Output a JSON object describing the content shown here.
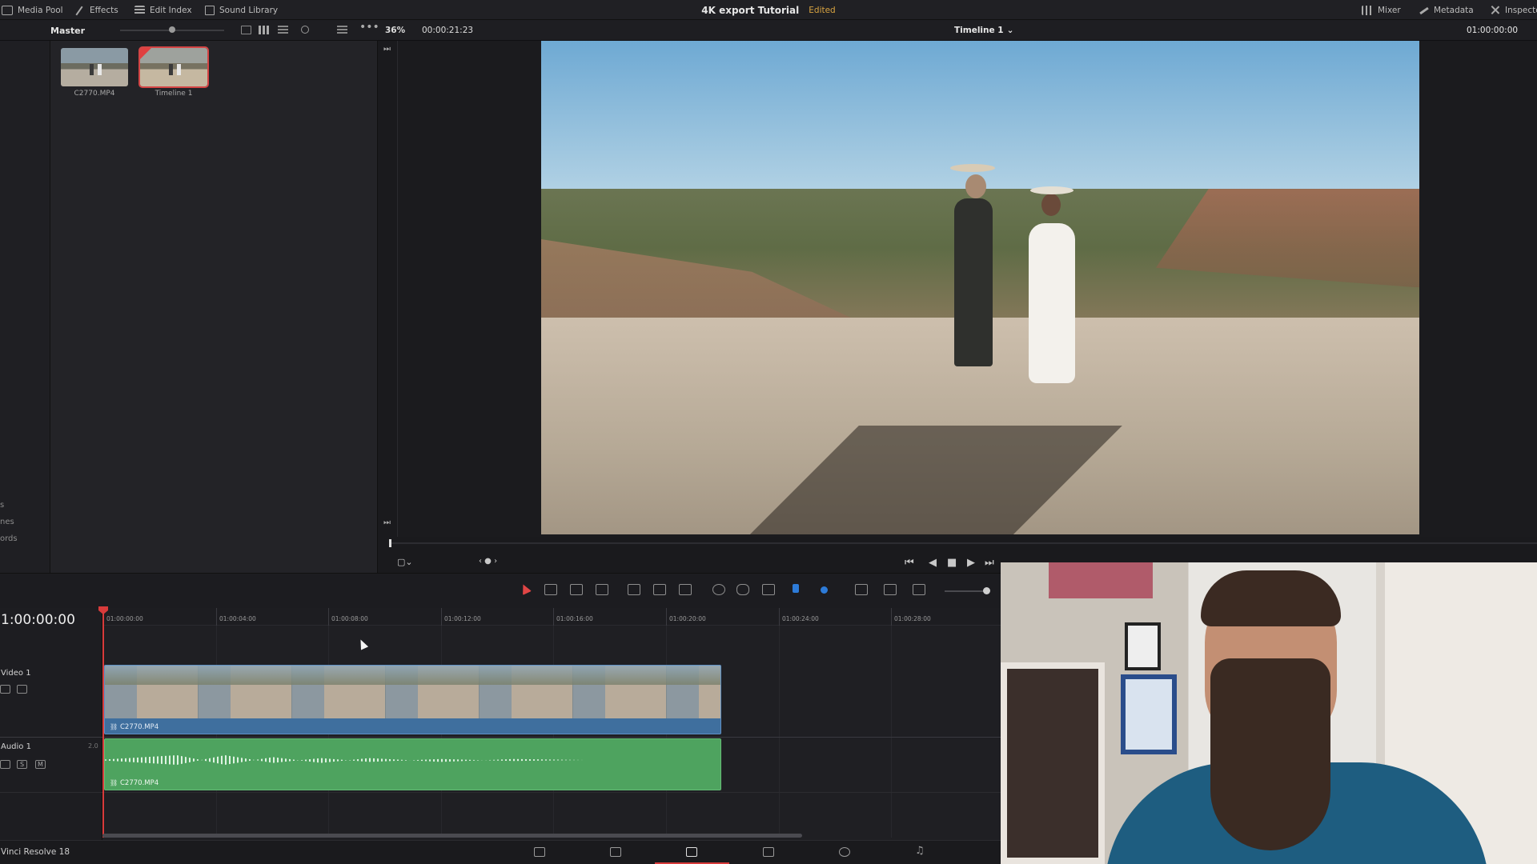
{
  "topbar": {
    "media_pool": "Media Pool",
    "effects": "Effects",
    "edit_index": "Edit Index",
    "sound_library": "Sound Library",
    "project_name": "4K export Tutorial",
    "edited": "Edited",
    "mixer": "Mixer",
    "metadata": "Metadata",
    "inspector": "Inspecto"
  },
  "subbar": {
    "bin": "Master",
    "zoom": "36%",
    "source_timecode": "00:00:21:23",
    "timeline": "Timeline 1",
    "record_timecode": "01:00:00:00"
  },
  "left_strip": [
    "s",
    "nes",
    "ords"
  ],
  "media_pool": {
    "clips": [
      {
        "name": "C2770.MP4",
        "selected": false
      },
      {
        "name": "Timeline 1",
        "selected": true
      }
    ]
  },
  "timeline": {
    "timecode": "1:00:00:00",
    "ruler": [
      "01:00:00:00",
      "01:00:04:00",
      "01:00:08:00",
      "01:00:12:00",
      "01:00:16:00",
      "01:00:20:00",
      "01:00:24:00",
      "01:00:28:00"
    ],
    "video_track": "Video 1",
    "audio_track": "Audio 1",
    "audio_channel": "2.0",
    "solo": "S",
    "mute": "M",
    "video_clip": "C2770.MP4",
    "audio_clip": "C2770.MP4"
  },
  "footer": {
    "app_name": "Vinci Resolve 18"
  },
  "colors": {
    "accent_red": "#d83b3b",
    "video_clip": "#3f6f9e",
    "audio_clip": "#4ea35f",
    "edited": "#d9a441",
    "marker_blue": "#2d7bd8"
  },
  "icons": [
    "media-pool-icon",
    "effects-icon",
    "edit-index-icon",
    "sound-library-icon",
    "mixer-icon",
    "metadata-icon",
    "inspector-icon",
    "search-icon",
    "play-icon",
    "stop-icon",
    "blade-icon",
    "link-icon",
    "lock-icon",
    "flag-icon"
  ]
}
